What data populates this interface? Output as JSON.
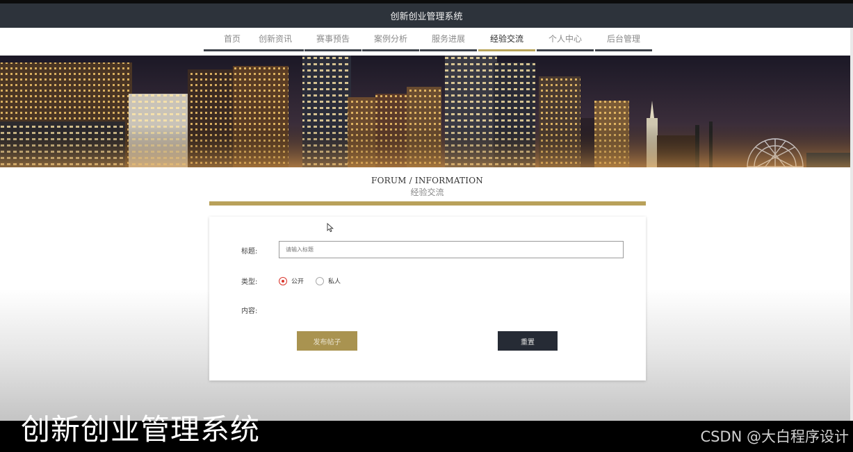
{
  "app": {
    "title": "创新创业管理系统"
  },
  "nav": {
    "items": [
      {
        "label": "首页"
      },
      {
        "label": "创新资讯"
      },
      {
        "label": "赛事预告"
      },
      {
        "label": "案例分析"
      },
      {
        "label": "服务进展"
      },
      {
        "label": "经验交流"
      },
      {
        "label": "个人中心"
      },
      {
        "label": "后台管理"
      }
    ],
    "active_index": 5
  },
  "section": {
    "title_en": "FORUM / INFORMATION",
    "title_zh": "经验交流"
  },
  "form": {
    "title_label": "标题:",
    "title_placeholder": "请输入标题",
    "type_label": "类型:",
    "type_options": [
      {
        "label": "公开",
        "checked": true
      },
      {
        "label": "私人",
        "checked": false
      }
    ],
    "content_label": "内容:",
    "submit_label": "发布帖子",
    "reset_label": "重置"
  },
  "overlay": {
    "caption": "创新创业管理系统",
    "watermark": "CSDN @大白程序设计"
  },
  "colors": {
    "header_bg": "#2d333b",
    "accent_gold": "#b9a15a",
    "active_underline": "#b8a45a",
    "radio_checked": "#d9342b",
    "reset_button": "#262b35"
  },
  "icons": {
    "banner": "city-night-skyline",
    "cursor": "mouse-pointer-icon"
  }
}
